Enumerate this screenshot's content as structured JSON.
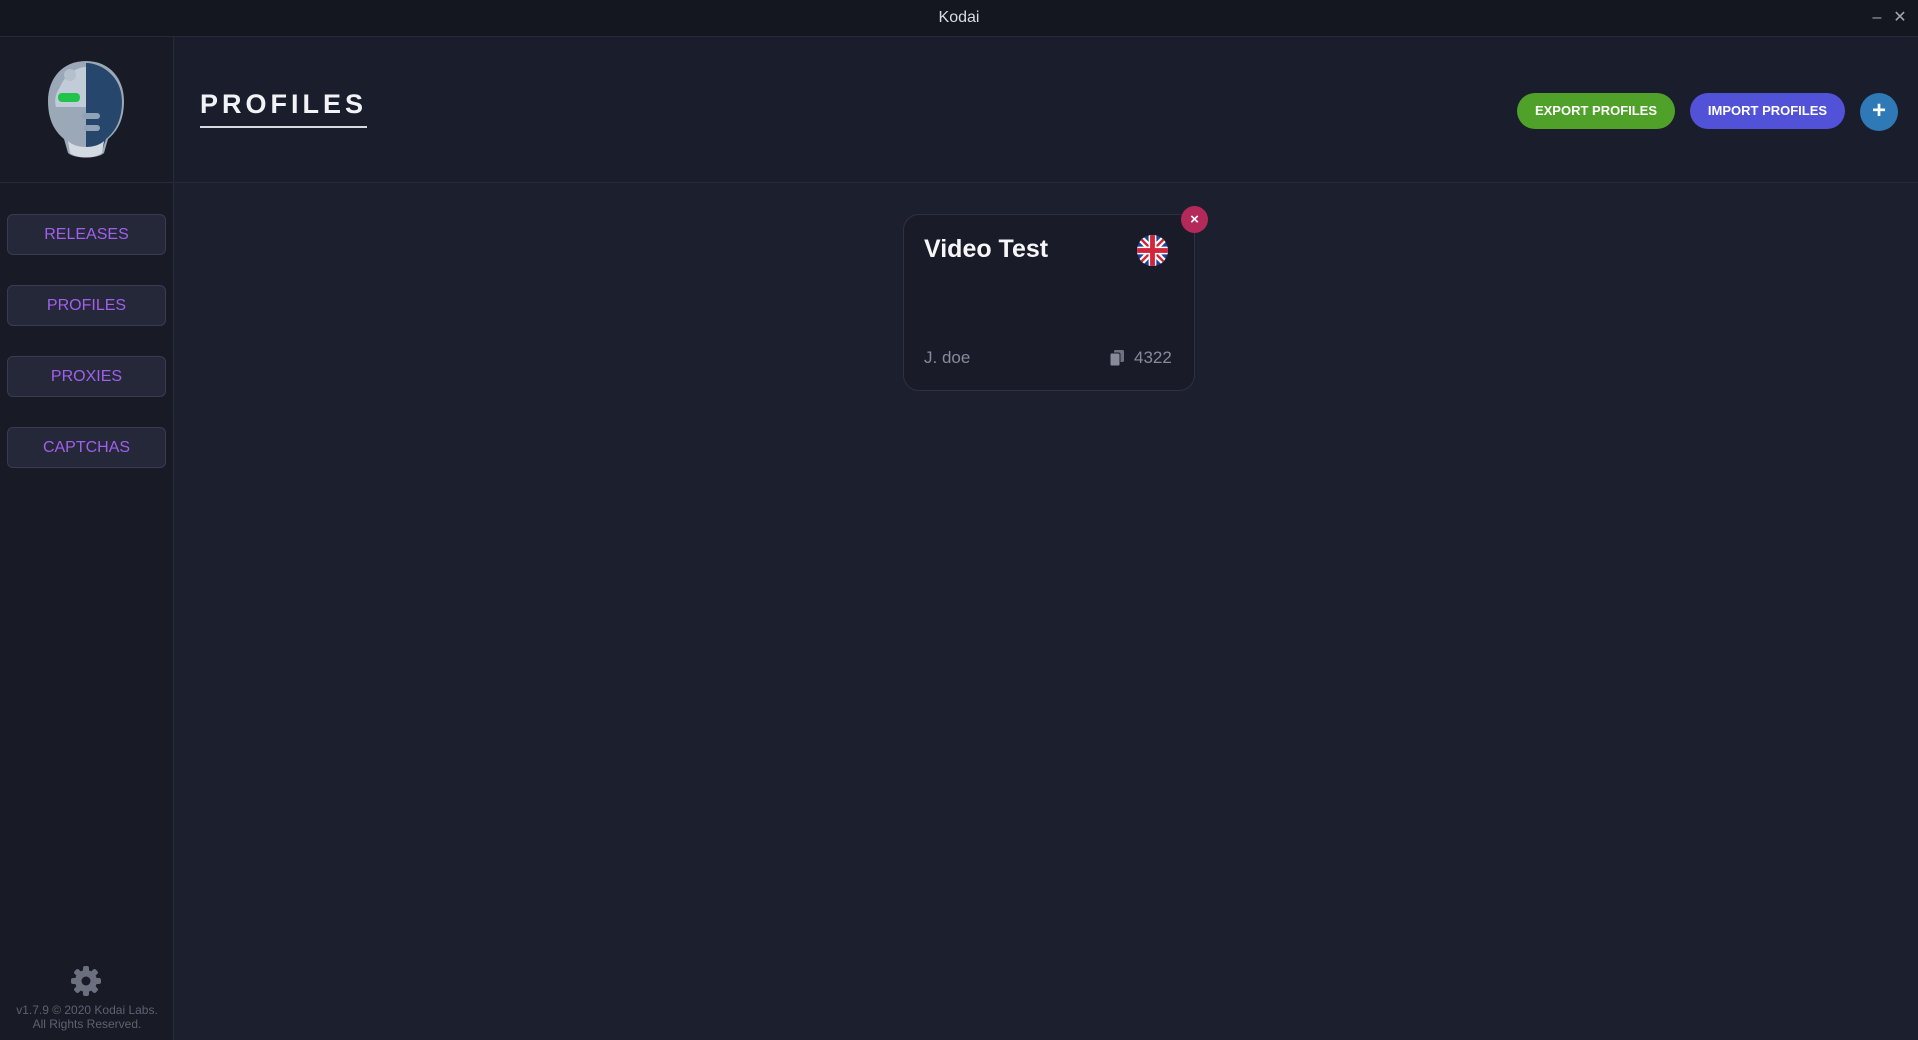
{
  "window": {
    "title": "Kodai",
    "minimize_label": "–",
    "close_label": "✕"
  },
  "sidebar": {
    "items": [
      {
        "label": "RELEASES"
      },
      {
        "label": "PROFILES"
      },
      {
        "label": "PROXIES"
      },
      {
        "label": "CAPTCHAS"
      }
    ],
    "version_line1": "v1.7.9 © 2020 Kodai Labs.",
    "version_line2": "All Rights Reserved."
  },
  "header": {
    "title": "PROFILES",
    "export_label": "EXPORT PROFILES",
    "import_label": "IMPORT PROFILES",
    "add_label": "+"
  },
  "profiles": [
    {
      "name": "Video Test",
      "holder": "J. doe",
      "card_last4": "4322",
      "country_flag": "uk-flag-icon",
      "delete_label": "×"
    }
  ],
  "colors": {
    "accent_purple": "#a060ec",
    "export_green": "#4fa12a",
    "import_indigo": "#5252d8",
    "add_blue": "#2e79b6",
    "delete_red": "#b32a5a"
  }
}
